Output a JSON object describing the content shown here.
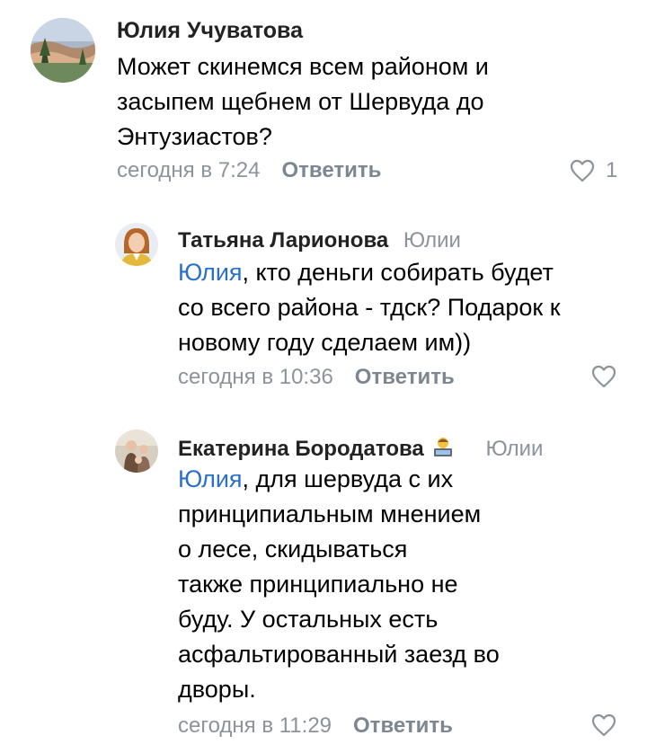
{
  "comments": [
    {
      "author": "Юлия Учуватова",
      "lines": [
        "Может скинемся всем районом и",
        "засыпем щебнем от Шервуда до",
        "Энтузиастов?"
      ],
      "time": "сегодня в 7:24",
      "reply_label": "Ответить",
      "likes": "1",
      "avatar_icon": "avatar-landscape-photo"
    },
    {
      "author": "Татьяна Ларионова",
      "reply_to": "Юлии",
      "mention": "Юлия",
      "first_line_rest": ", кто деньги собирать будет",
      "lines": [
        "со всего района - тдск? Подарок к",
        "новому году сделаем им))"
      ],
      "time": "сегодня в 10:36",
      "reply_label": "Ответить",
      "avatar_icon": "avatar-woman-photo"
    },
    {
      "author": "Екатерина Бородатова",
      "badge_icon": "technologist-emoji-icon",
      "reply_to": "Юлии",
      "mention": "Юлия",
      "first_line_rest": ", для шервуда с их",
      "lines": [
        "принципиальным мнением",
        "о лесе, скидываться",
        "также принципиально не",
        "буду. У остальных есть",
        "асфальтированный заезд во",
        "дворы."
      ],
      "time": "сегодня в 11:29",
      "reply_label": "Ответить",
      "avatar_icon": "avatar-family-photo"
    }
  ]
}
